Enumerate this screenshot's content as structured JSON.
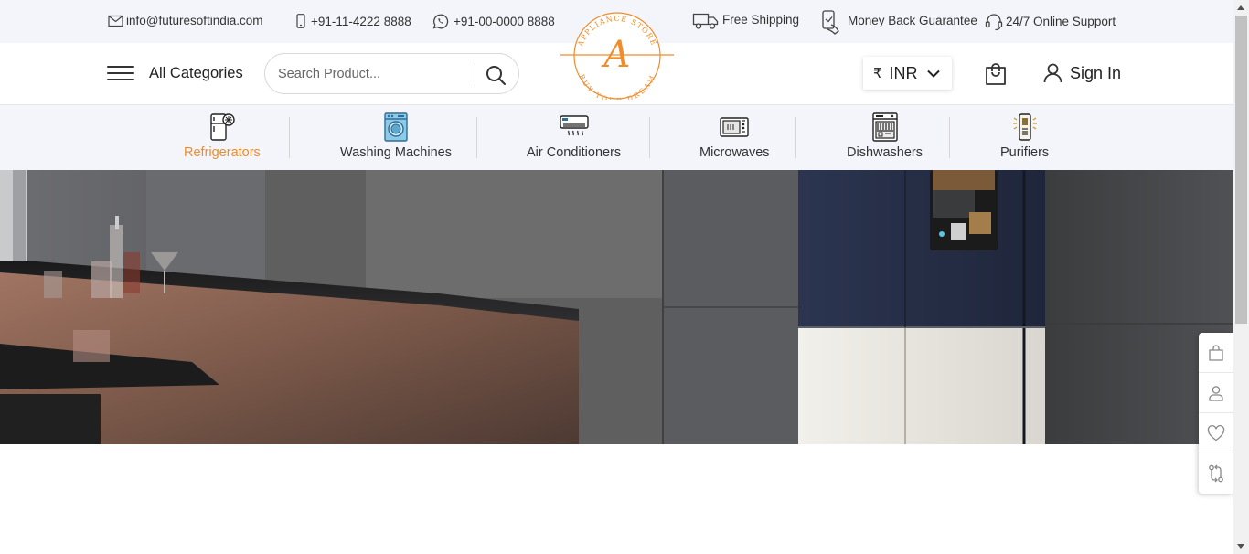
{
  "topbar": {
    "email": "info@futuresoftindia.com",
    "phone": "+91-11-4222 8888",
    "whatsapp": "+91-00-0000 8888",
    "shipping": "Free Shipping",
    "guarantee": "Money Back Guarantee",
    "support": "24/7 Online Support"
  },
  "header": {
    "all_categories": "All Categories",
    "search_placeholder": "Search Product...",
    "logo_letter": "A",
    "logo_text_top": "APPLIANCE STORE",
    "logo_text_bottom": "BUY YOUR DREAM",
    "currency_symbol": "₹",
    "currency": "INR",
    "sign_in": "Sign In"
  },
  "categories": [
    {
      "label": "Refrigerators",
      "icon": "refrigerator-icon",
      "active": true
    },
    {
      "label": "Washing Machines",
      "icon": "washing-machine-icon",
      "active": false
    },
    {
      "label": "Air Conditioners",
      "icon": "air-conditioner-icon",
      "active": false
    },
    {
      "label": "Microwaves",
      "icon": "microwave-icon",
      "active": false
    },
    {
      "label": "Dishwashers",
      "icon": "dishwasher-icon",
      "active": false
    },
    {
      "label": "Purifiers",
      "icon": "purifier-icon",
      "active": false
    }
  ],
  "sidebar_icons": [
    "shopping-bag-icon",
    "user-icon",
    "heart-icon",
    "compare-icon"
  ],
  "colors": {
    "accent": "#f08c2a",
    "topbar_bg": "#f3f5fa",
    "text": "#222222"
  }
}
